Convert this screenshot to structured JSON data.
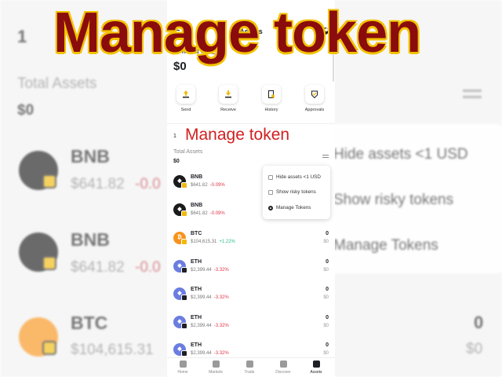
{
  "overlay": {
    "title": "Manage token",
    "subtitle": "Manage token"
  },
  "background": {
    "top_number": "1",
    "total_assets_label": "Total Assets",
    "total_value": "$0",
    "menu": [
      "Hide assets <1 USD",
      "Show risky tokens",
      "Manage Tokens"
    ],
    "rows": [
      {
        "symbol": "BNB",
        "price": "$641.82",
        "change": "-0.0"
      },
      {
        "symbol": "BNB",
        "price": "$641.82",
        "change": "-0.0"
      },
      {
        "symbol": "BTC",
        "price": "$104,615.31",
        "change": ""
      }
    ],
    "right_amount": "0",
    "right_usd": "$0"
  },
  "phone": {
    "header": {
      "title": "Assets"
    },
    "wallet": {
      "name": "Wallet1",
      "caret": "⌄"
    },
    "balance": "$0",
    "actions": [
      {
        "label": "Send",
        "icon": "send-icon"
      },
      {
        "label": "Receive",
        "icon": "receive-icon"
      },
      {
        "label": "History",
        "icon": "history-icon"
      },
      {
        "label": "Approvals",
        "icon": "approvals-icon"
      }
    ],
    "section_number": "1",
    "total_assets_label": "Total Assets",
    "total_value": "$0",
    "popup": {
      "options": [
        {
          "label": "Hide assets <1 USD",
          "selected": false
        },
        {
          "label": "Show risky tokens",
          "selected": false
        },
        {
          "label": "Manage Tokens",
          "selected": true
        }
      ]
    },
    "tokens": [
      {
        "symbol": "BNB",
        "price": "$641.82",
        "change": "-0.09%",
        "amount": "",
        "usd": "",
        "coin": "bnb"
      },
      {
        "symbol": "BNB",
        "price": "$641.82",
        "change": "-0.09%",
        "amount": "",
        "usd": "",
        "coin": "bnb"
      },
      {
        "symbol": "BTC",
        "price": "$104,615.31",
        "change": "+1.22%",
        "amount": "0",
        "usd": "$0",
        "coin": "btc"
      },
      {
        "symbol": "ETH",
        "price": "$2,399.44",
        "change": "-3.32%",
        "amount": "0",
        "usd": "$0",
        "coin": "eth"
      },
      {
        "symbol": "ETH",
        "price": "$2,399.44",
        "change": "-3.32%",
        "amount": "0",
        "usd": "$0",
        "coin": "eth"
      },
      {
        "symbol": "ETH",
        "price": "$2,399.44",
        "change": "-3.32%",
        "amount": "0",
        "usd": "$0",
        "coin": "eth"
      },
      {
        "symbol": "ETH",
        "price": "$2,399.44",
        "change": "-3.32%",
        "amount": "0",
        "usd": "$0",
        "coin": "eth"
      }
    ],
    "nav": [
      {
        "label": "Home",
        "icon": "home-icon",
        "active": false
      },
      {
        "label": "Markets",
        "icon": "markets-icon",
        "active": false
      },
      {
        "label": "Trade",
        "icon": "trade-icon",
        "active": false
      },
      {
        "label": "Discover",
        "icon": "discover-icon",
        "active": false
      },
      {
        "label": "Assets",
        "icon": "assets-icon",
        "active": true
      }
    ]
  },
  "colors": {
    "accent": "#f0b90b",
    "negative": "#e0394c",
    "positive": "#2ebd85",
    "title_red": "#8a0c0c",
    "label_red": "#d21f1f"
  }
}
